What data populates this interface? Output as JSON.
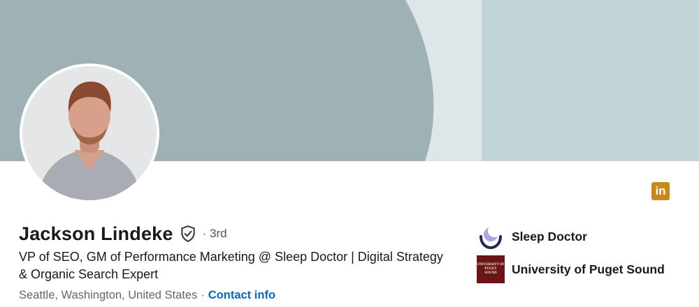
{
  "profile": {
    "name": "Jackson Lindeke",
    "connection_degree": "· 3rd",
    "headline": "VP of SEO, GM of Performance Marketing @ Sleep Doctor | Digital Strategy & Organic Search Expert",
    "location": "Seattle, Washington, United States",
    "location_separator": "·",
    "contact_link": "Contact info"
  },
  "linkedin_badge": {
    "label": "in",
    "icon": "linkedin-icon",
    "color": "#c8891c"
  },
  "organizations": [
    {
      "name": "Sleep Doctor",
      "icon": "sleep-doctor-moon-logo"
    },
    {
      "name": "University of Puget Sound",
      "icon": "university-crest-logo",
      "logo_text": [
        "UNIVERSITY OF",
        "PUGET",
        "SOUND"
      ]
    }
  ],
  "colors": {
    "banner_circle": "#9eb2b5",
    "banner_pale": "#dde6e8",
    "banner_right": "#c1d4d8",
    "link": "#0a66c2"
  }
}
